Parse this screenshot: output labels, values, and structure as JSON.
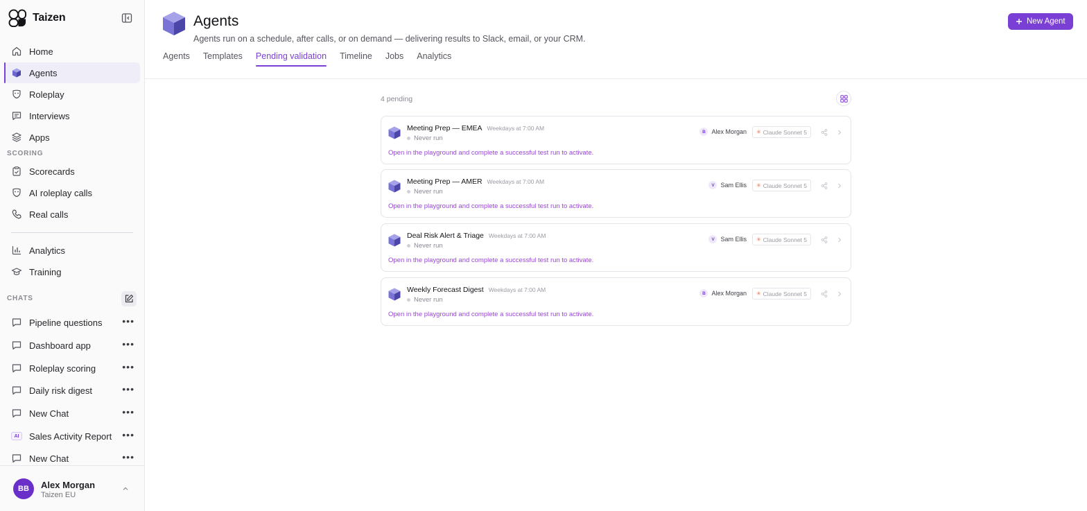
{
  "app": {
    "name": "Taizen"
  },
  "sidebar": {
    "nav": [
      {
        "label": "Home",
        "icon": "home-icon"
      },
      {
        "label": "Agents",
        "icon": "cube-icon",
        "active": true
      },
      {
        "label": "Roleplay",
        "icon": "roleplay-icon"
      },
      {
        "label": "Interviews",
        "icon": "chat-icon"
      },
      {
        "label": "Apps",
        "icon": "apps-icon"
      }
    ],
    "scoring_label": "SCORING",
    "scoring": [
      {
        "label": "Scorecards",
        "icon": "clipboard-icon"
      },
      {
        "label": "AI roleplay calls",
        "icon": "roleplay-icon"
      },
      {
        "label": "Real calls",
        "icon": "phone-icon"
      }
    ],
    "more": [
      {
        "label": "Analytics",
        "icon": "bar-chart-icon"
      },
      {
        "label": "Training",
        "icon": "graduation-cap-icon"
      }
    ],
    "chats_label": "CHATS",
    "chats": [
      {
        "label": "Pipeline questions",
        "icon": "chat-icon"
      },
      {
        "label": "Dashboard app",
        "icon": "chat-icon"
      },
      {
        "label": "Roleplay scoring",
        "icon": "chat-icon"
      },
      {
        "label": "Daily risk digest",
        "icon": "chat-icon"
      },
      {
        "label": "New Chat",
        "icon": "chat-icon"
      },
      {
        "label": "Sales Activity Report",
        "icon": "ai-badge",
        "badge": "AI"
      },
      {
        "label": "New Chat",
        "icon": "chat-icon"
      }
    ],
    "user": {
      "initials": "BB",
      "name": "Alex Morgan",
      "org": "Taizen EU"
    }
  },
  "header": {
    "title": "Agents",
    "subtitle": "Agents run on a schedule, after calls, or on demand — delivering results to Slack, email, or your CRM.",
    "new_agent_label": "New Agent",
    "tabs": [
      {
        "label": "Agents"
      },
      {
        "label": "Templates"
      },
      {
        "label": "Pending validation",
        "active": true
      },
      {
        "label": "Timeline"
      },
      {
        "label": "Jobs"
      },
      {
        "label": "Analytics"
      }
    ]
  },
  "pending": {
    "count_label": "4 pending",
    "items": [
      {
        "name": "Meeting Prep — EMEA",
        "schedule": "Weekdays at 7:00 AM",
        "status": "Never run",
        "owner_initial": "B",
        "owner": "Alex Morgan",
        "model": "Claude Sonnet 5",
        "hint": "Open in the playground and complete a successful test run to activate."
      },
      {
        "name": "Meeting Prep — AMER",
        "schedule": "Weekdays at 7:00 AM",
        "status": "Never run",
        "owner_initial": "V",
        "owner": "Sam Ellis",
        "model": "Claude Sonnet 5",
        "hint": "Open in the playground and complete a successful test run to activate."
      },
      {
        "name": "Deal Risk Alert & Triage",
        "schedule": "Weekdays at 7:00 AM",
        "status": "Never run",
        "owner_initial": "V",
        "owner": "Sam Ellis",
        "model": "Claude Sonnet 5",
        "hint": "Open in the playground and complete a successful test run to activate."
      },
      {
        "name": "Weekly Forecast Digest",
        "schedule": "Weekdays at 7:00 AM",
        "status": "Never run",
        "owner_initial": "B",
        "owner": "Alex Morgan",
        "model": "Claude Sonnet 5",
        "hint": "Open in the playground and complete a successful test run to activate."
      }
    ]
  },
  "colors": {
    "accent": "#7a3fd4",
    "hint": "#9a45d6",
    "cube_light": "#8c87e0",
    "cube_dark": "#4b46a8",
    "model_spark": "#d97757"
  }
}
